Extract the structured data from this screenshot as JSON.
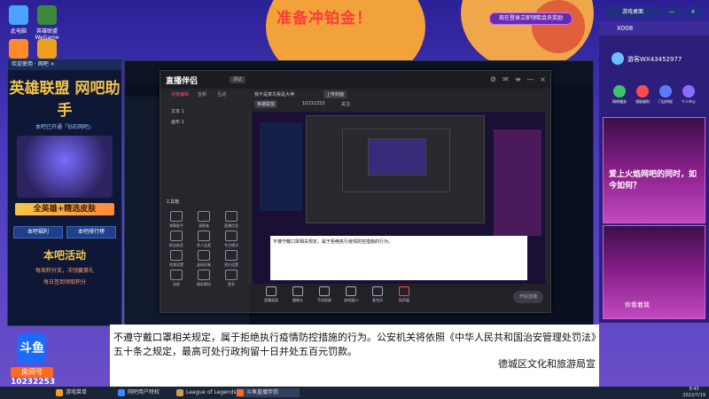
{
  "headline": "准备冲铂金！",
  "desktop_icons": [
    {
      "label": "此电脑",
      "icon": "computer-icon",
      "color": "#4aa3ff"
    },
    {
      "label": "英雄联盟WeGame",
      "icon": "game-icon",
      "color": "#3a8a3a"
    },
    {
      "label": "",
      "icon": "app-icon",
      "color": "#ff8a2a"
    },
    {
      "label": "",
      "icon": "wegame-icon",
      "color": "#f0a020"
    }
  ],
  "promo": {
    "bar_text": "欢迎使用 · 网吧 ×",
    "logo": "英雄联盟 网吧助手",
    "sub": "本吧已开通「钻石网吧」",
    "banner": "全英雄+精选皮肤",
    "btn1": "本吧福利",
    "btn2": "本吧排行榜",
    "activity": "本吧活动",
    "line1": "每周积分奖，冲顶赢豪礼",
    "line2": "每日签到领取积分"
  },
  "stream": {
    "brand": "直播伴侣",
    "badge": "测试",
    "tabs": [
      "场景编辑",
      "音频",
      "互动"
    ],
    "sources": [
      "文本 1",
      "画布 1"
    ],
    "tools_title": "工具箱",
    "tools": [
      "弹幕助手",
      "观察者",
      "直播信息",
      "粉丝抽奖",
      "多人连麦",
      "专注模式",
      "视频设置",
      "虚拟形象",
      "旁白设置",
      "录屏",
      "精彩瞬间",
      "更多"
    ],
    "topbar": {
      "room_title": "我不是菜鸟我是大神",
      "edit": "上传封面",
      "category": "英雄联盟",
      "account_id": "10232253",
      "follow_label": "关注"
    },
    "bottom": [
      "直播画面",
      "摄像头",
      "手机投屏",
      "游戏窗口",
      "麦克风",
      "扬声器"
    ],
    "start": "开始直播",
    "subtitle_line": "不遵守戴口罩相关规定，属于拒绝执行疫情防控措施的行为。"
  },
  "right_panel": {
    "header": "X008",
    "user": "游客WX43452977",
    "buttons": [
      {
        "label": "网吧服务",
        "color": "#3cc46a"
      },
      {
        "label": "领取福利",
        "color": "#ff4b4b"
      },
      {
        "label": "门店特权",
        "color": "#5a7bff"
      },
      {
        "label": "个人中心",
        "color": "#8a6cff"
      }
    ],
    "promo_text": "爱上火焰网吧的同时，如今如何？",
    "promo2": "你看着我"
  },
  "top_right": {
    "pill1": "现在登录立即领取会员奖励",
    "pill2": "游戏桌面",
    "min": "—",
    "close": "×"
  },
  "subtitle": {
    "line1": "不遵守戴口罩相关规定，属于拒绝执行疫情防控措施的行为。公安机关将依照《中华人民共和国治安管理处罚法》",
    "line2": "五十条之规定，最高可处行政拘留十日并处五百元罚款。",
    "source": "德城区文化和旅游局宣"
  },
  "channel": {
    "logo": "斗鱼",
    "room_label": "房间号",
    "room_id": "10232253"
  },
  "taskbar": {
    "items": [
      {
        "label": "游戏菜单",
        "color": "#f0a020"
      },
      {
        "label": "网吧用户特权",
        "color": "#3a8aff"
      },
      {
        "label": "League of Legends",
        "color": "#c8a24a"
      },
      {
        "label": "斗鱼直播伴侣",
        "color": "#ff6b1a"
      }
    ],
    "time": "8:45",
    "date": "2022/7/19"
  }
}
